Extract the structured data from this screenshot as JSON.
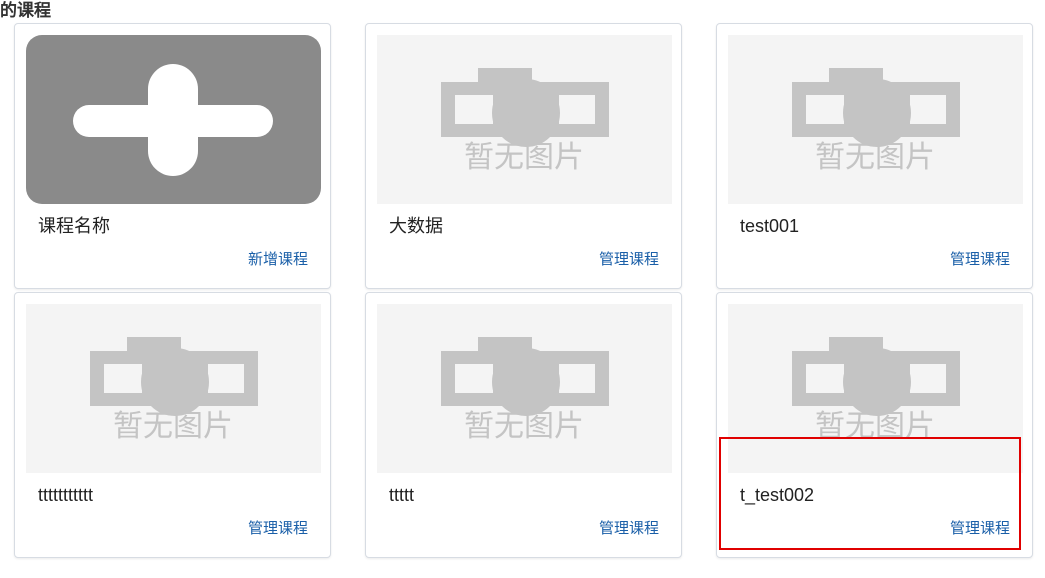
{
  "section": {
    "title": "的课程"
  },
  "placeholder": {
    "image_text": "暂无图片",
    "icon": "camera-icon"
  },
  "add_card": {
    "name": "课程名称",
    "action_label": "新增课程",
    "icon": "plus-icon"
  },
  "courses": [
    {
      "name": "大数据",
      "action_label": "管理课程"
    },
    {
      "name": "test001",
      "action_label": "管理课程"
    },
    {
      "name": "ttttttttttt",
      "action_label": "管理课程"
    },
    {
      "name": "ttttt",
      "action_label": "管理课程"
    },
    {
      "name": "t_test002",
      "action_label": "管理课程"
    }
  ],
  "colors": {
    "link": "#1a5fa8",
    "highlight": "#e00000",
    "add_tile": "#8a8a8a",
    "placeholder_bg": "#f4f4f4",
    "placeholder_fg": "#c4c4c4"
  }
}
